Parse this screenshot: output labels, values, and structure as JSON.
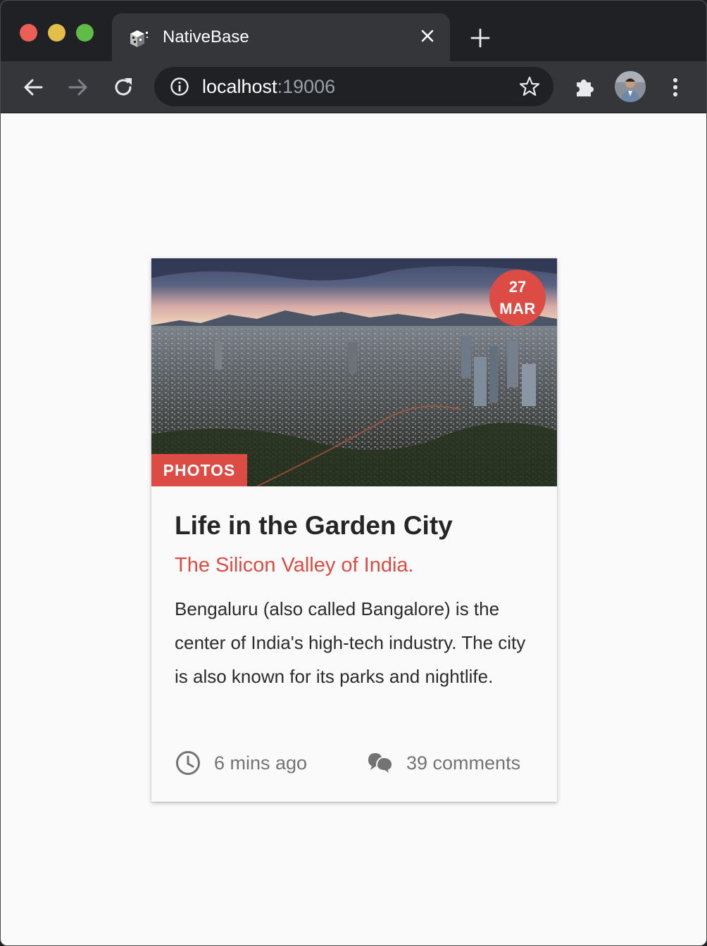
{
  "browser": {
    "tab_title": "NativeBase",
    "url_host": "localhost",
    "url_port": ":19006"
  },
  "card": {
    "date_day": "27",
    "date_month": "MAR",
    "category": "PHOTOS",
    "title": "Life in the Garden City",
    "subtitle": "The Silicon Valley of India.",
    "description": "Bengaluru (also called Bangalore) is the center of India's high-tech industry. The city is also known for its parks and nightlife.",
    "time_ago": "6 mins ago",
    "comments": "39 comments"
  },
  "colors": {
    "accent": "#dc4c45",
    "title_text": "#262626",
    "meta_text": "#737373",
    "browser_frame": "#202124",
    "browser_toolbar": "#35363a"
  },
  "icons": {
    "tab_favicon": "nativebase-cube-icon",
    "tab_close": "close-icon",
    "new_tab": "plus-icon",
    "back": "arrow-left-icon",
    "forward": "arrow-right-icon",
    "reload": "reload-icon",
    "site_info": "info-icon",
    "bookmark": "star-icon",
    "extensions": "puzzle-icon",
    "menu": "more-vertical-icon",
    "time": "clock-icon",
    "comments": "chat-bubbles-icon"
  }
}
